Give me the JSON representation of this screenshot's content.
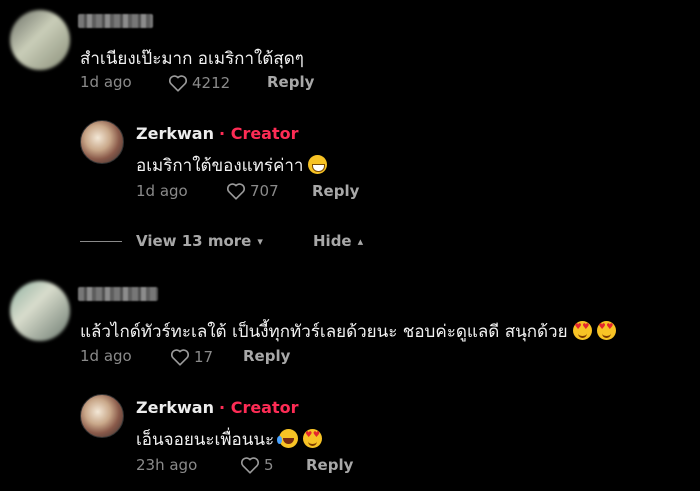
{
  "comments": [
    {
      "text": "สำเนียงเป๊ะมาก อเมริกาใต้สุดๆ",
      "time": "1d ago",
      "likes": "4212",
      "reply_label": "Reply",
      "reply": {
        "author": "Zerkwan",
        "tag": "· Creator",
        "text": "อเมริกาใต้ของแทร่ค่าา",
        "emoji": "grinning-face-icon",
        "time": "1d ago",
        "likes": "707",
        "reply_label": "Reply"
      }
    },
    {
      "text": "แล้วไกด์ทัวร์ทะเลใต้ เป็นงี้ทุกทัวร์เลยด้วยนะ ชอบค่ะดูแลดี สนุกด้วย",
      "emoji": [
        "smiling-face-with-hearts-icon",
        "smiling-face-with-hearts-icon"
      ],
      "time": "1d ago",
      "likes": "17",
      "reply_label": "Reply",
      "reply": {
        "author": "Zerkwan",
        "tag": "· Creator",
        "text": "เอ็นจอยนะเพื่อนนะ",
        "emoji": [
          "tears-of-joy-icon",
          "smiling-face-with-hearts-icon"
        ],
        "time": "23h ago",
        "likes": "5",
        "reply_label": "Reply"
      }
    }
  ],
  "thread_controls": {
    "view_more": "View 13 more",
    "hide": "Hide"
  },
  "colors": {
    "background": "#000000",
    "creator_tag": "#fe2c55",
    "meta": "#8a8a8a"
  }
}
